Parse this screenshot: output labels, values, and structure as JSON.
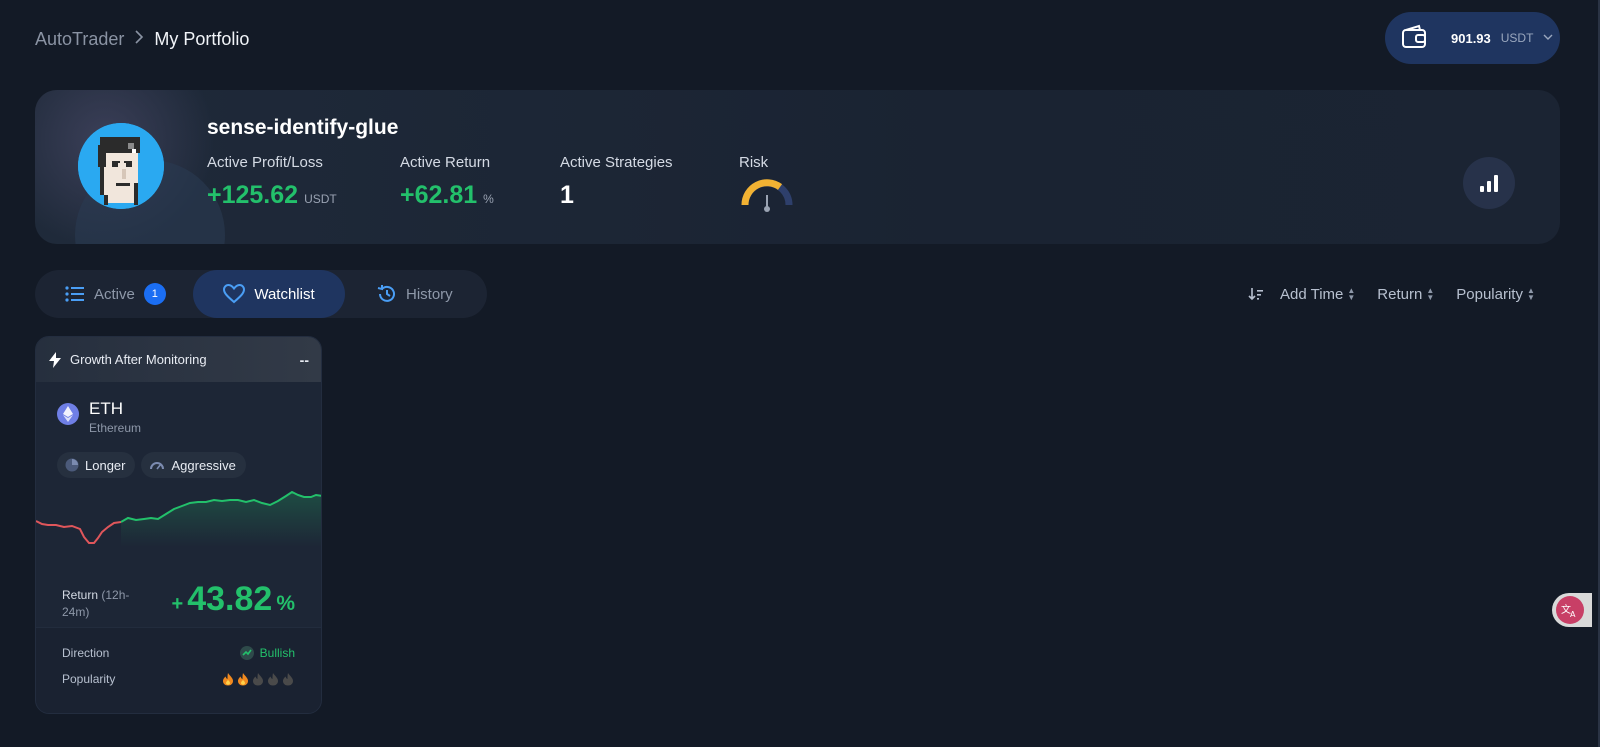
{
  "breadcrumb": {
    "root": "AutoTrader",
    "separator": ">",
    "current": "My Portfolio"
  },
  "wallet": {
    "amount": "901.93",
    "currency": "USDT",
    "icon": "wallet-icon"
  },
  "profile": {
    "username": "sense-identify-glue",
    "stats": {
      "profit_loss": {
        "label": "Active Profit/Loss",
        "value": "+125.62",
        "unit": "USDT"
      },
      "return": {
        "label": "Active Return",
        "value": "+62.81",
        "unit": "%"
      },
      "strategies": {
        "label": "Active Strategies",
        "value": "1"
      },
      "risk": {
        "label": "Risk",
        "level": 0.65
      }
    }
  },
  "tabs": [
    {
      "label": "Active",
      "badge": "1",
      "icon": "list-icon",
      "active": false
    },
    {
      "label": "Watchlist",
      "icon": "heart-icon",
      "active": true
    },
    {
      "label": "History",
      "icon": "history-icon",
      "active": false
    }
  ],
  "sort": {
    "icon": "sort-desc-icon",
    "options": [
      "Add Time",
      "Return",
      "Popularity"
    ]
  },
  "card": {
    "header": "Growth After Monitoring",
    "header_right": "--",
    "coin": {
      "symbol": "ETH",
      "name": "Ethereum"
    },
    "tags": [
      "Longer",
      "Aggressive"
    ],
    "return_label": "Return",
    "return_period": "(12h-24m)",
    "return_sign": "+",
    "return_value": "43.82",
    "return_unit": "%",
    "direction_label": "Direction",
    "direction_value": "Bullish",
    "popularity_label": "Popularity",
    "popularity_level": 2,
    "popularity_max": 5
  },
  "colors": {
    "accent_green": "#23c06b",
    "accent_red": "#e0565b",
    "tab_active": "#1f3560",
    "badge": "#1b6ef3"
  }
}
